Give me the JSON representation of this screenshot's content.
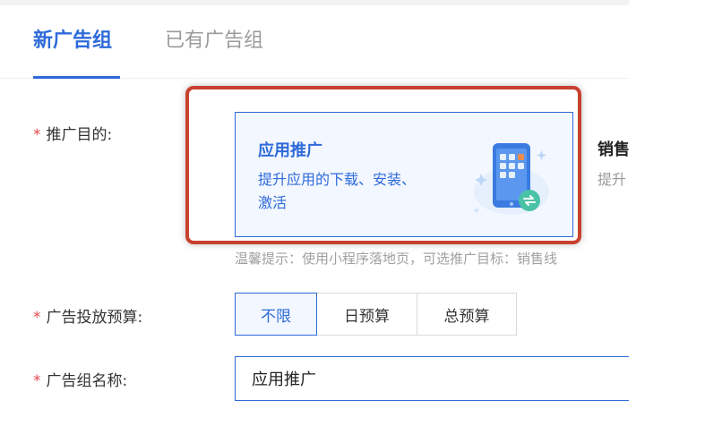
{
  "tabs": [
    {
      "label": "新广告组"
    },
    {
      "label": "已有广告组"
    }
  ],
  "form": {
    "required_mark": "*",
    "goal": {
      "label": "推广目的:",
      "options": [
        {
          "title": "应用推广",
          "desc": "提升应用的下载、安装、激活",
          "selected": true,
          "icon": "phone-app-illustration"
        },
        {
          "title": "销售",
          "desc": "提升",
          "selected": false
        }
      ],
      "hint": "温馨提示：使用小程序落地页，可选推广目标：销售线"
    },
    "budget": {
      "label": "广告投放预算:",
      "options": [
        {
          "label": "不限",
          "selected": true
        },
        {
          "label": "日预算",
          "selected": false
        },
        {
          "label": "总预算",
          "selected": false
        }
      ]
    },
    "name": {
      "label": "广告组名称:",
      "value": "应用推广"
    }
  },
  "colors": {
    "accent": "#2e6bd9",
    "highlight_border": "#c8412f",
    "required": "#e5484d"
  }
}
